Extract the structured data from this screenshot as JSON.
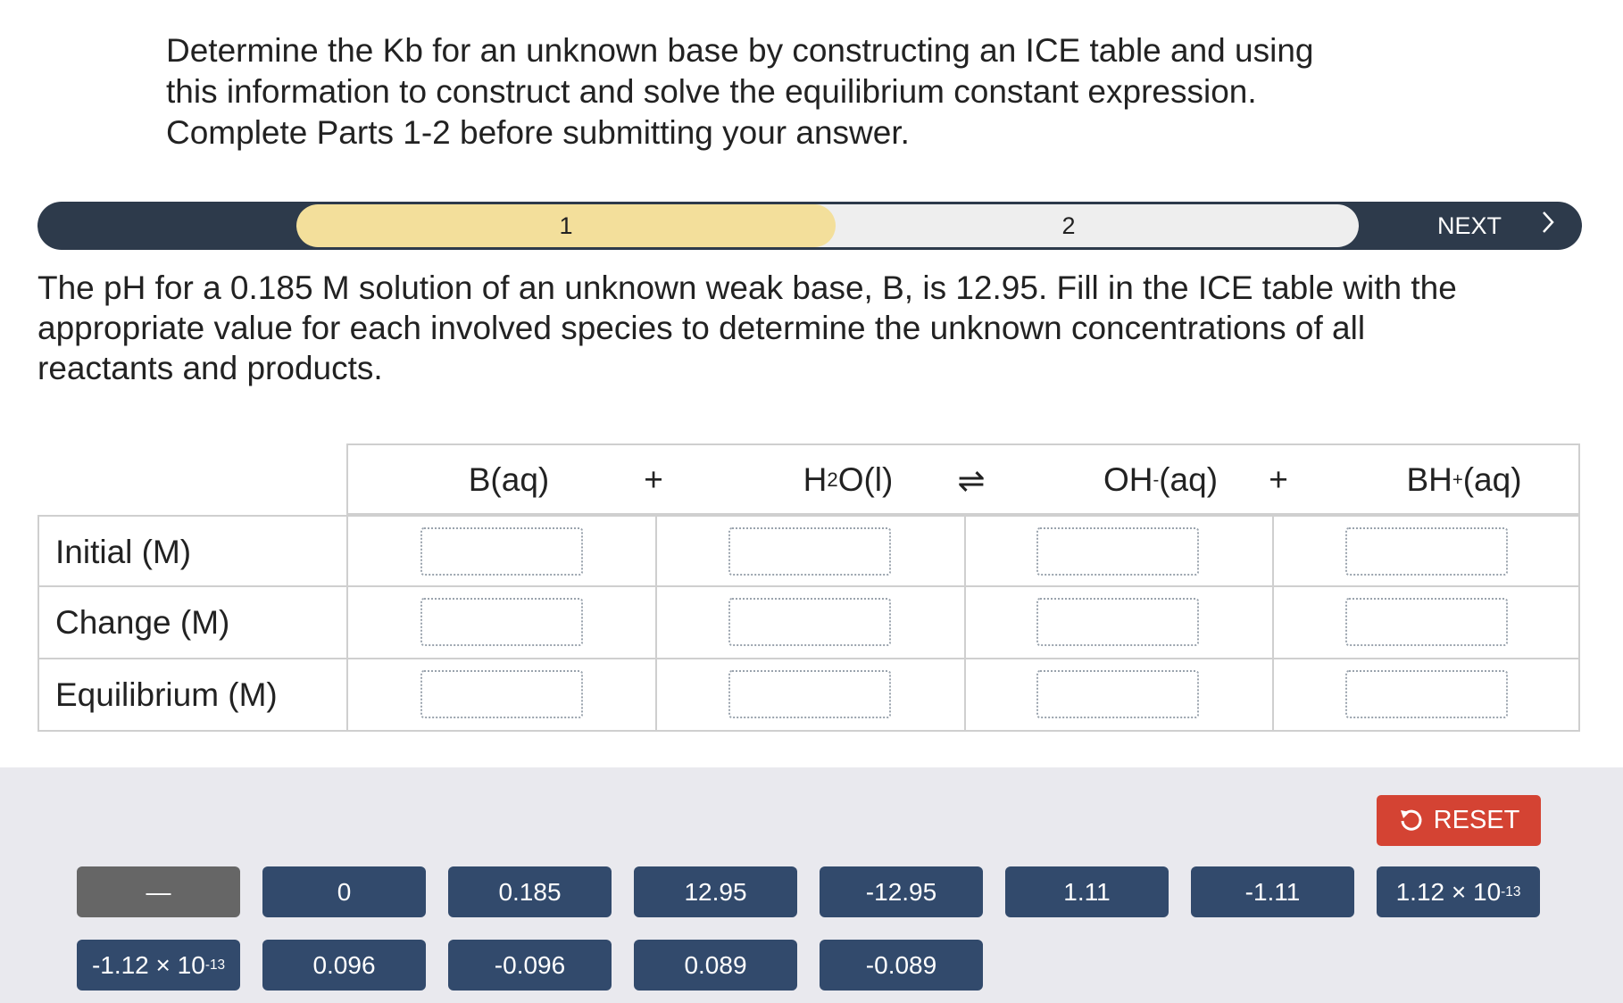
{
  "intro": {
    "line1": "Determine the Kb for an unknown base by constructing an ICE table and using",
    "line2": "this information to construct and solve the equilibrium constant expression.",
    "line3": "Complete Parts 1-2 before submitting your answer."
  },
  "stepper": {
    "step1": "1",
    "step2": "2",
    "next_label": "NEXT",
    "next_icon": "chevron-right-icon"
  },
  "question": {
    "line1": "The pH for a 0.185 M solution of an unknown weak base, B, is 12.95. Fill in the ICE table with the",
    "line2": "appropriate value for each involved species to determine the unknown concentrations of all",
    "line3": "reactants and products."
  },
  "ice_table": {
    "species": {
      "b": "B(aq)",
      "plus1": "+",
      "h2o_h": "H",
      "h2o_sub": "2",
      "h2o_rest": "O(l)",
      "equilibrium_arrow": "⇌",
      "oh_base": "OH",
      "oh_sup": "-",
      "oh_rest": "(aq)",
      "plus2": "+",
      "bh_base": "BH",
      "bh_sup": "+",
      "bh_rest": "(aq)"
    },
    "rows": [
      "Initial (M)",
      "Change (M)",
      "Equilibrium (M)"
    ]
  },
  "tray": {
    "reset_label": "RESET",
    "tiles_row1": [
      {
        "label": "—"
      },
      {
        "label": "0"
      },
      {
        "label": "0.185"
      },
      {
        "label": "12.95"
      },
      {
        "label": "-12.95"
      },
      {
        "label": "1.11"
      },
      {
        "label": "-1.11"
      },
      {
        "base": "1.12 × 10",
        "exp": "-13"
      }
    ],
    "tiles_row2": [
      {
        "base": "-1.12 × 10",
        "exp": "-13"
      },
      {
        "label": "0.096"
      },
      {
        "label": "-0.096"
      },
      {
        "label": "0.089"
      },
      {
        "label": "-0.089"
      }
    ]
  },
  "colors": {
    "tile_bg": "#324a6c",
    "tile_grey": "#666666",
    "reset_bg": "#d44333",
    "step_active": "#f3df9b",
    "stepbar_bg": "#2d3a4b"
  }
}
